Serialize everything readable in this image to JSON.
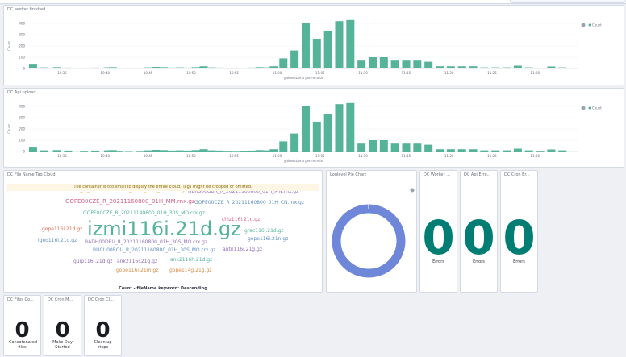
{
  "topbar": {},
  "panels": {
    "worker": {
      "title": "DC worker finished",
      "xlabel": "@timestamp per minute",
      "ylabel": "Count",
      "legend": "Count"
    },
    "upload": {
      "title": "DC Api upload",
      "xlabel": "@timestamp per minute",
      "ylabel": "Count",
      "legend": "Count"
    },
    "tagcloud": {
      "title": "DC File Name Tag Cloud",
      "warning": "The container is too small to display the entire cloud. Tags might be cropped or omitted.",
      "caption": "Count - fileName.keyword: Descending"
    },
    "pie": {
      "title": "Loglevel Pie Chart"
    },
    "metrics": [
      {
        "title": "DC Worker ...",
        "value": "0",
        "label": "Errors"
      },
      {
        "title": "DC Api Erro...",
        "value": "0",
        "label": "Errors"
      },
      {
        "title": "DC Cron Er...",
        "value": "0",
        "label": "Errors"
      }
    ],
    "bottom_metrics": [
      {
        "title": "DC Files Co...",
        "value": "0",
        "label": "Concatenated files"
      },
      {
        "title": "DC Cron M...",
        "value": "0",
        "label": "Make Day Started"
      },
      {
        "title": "DC Cron Cl...",
        "value": "0",
        "label": "Clean up steps"
      }
    ]
  },
  "cloud_words": [
    {
      "text": "WTZ000DEU_R_20211160800_01H_30S_MO.crx.gz",
      "color": "#d6bf57"
    },
    {
      "text": "HERS00GBR_R_20211160800_01H_MN.rnx.gz",
      "color": "#9170b8"
    },
    {
      "text": "GOPE00CZE_R_20211160800_01H_MM.rnx.gz",
      "color": "#d36086"
    },
    {
      "text": "GOPE00CZE_R_20211160800_01H_CN.rnx.gz",
      "color": "#6092c0"
    },
    {
      "text": "GOPE00CZE_R_20211140600_01H_30S_MO.crx.gz",
      "color": "#54b399"
    },
    {
      "text": "chiz116i.21d.gz",
      "color": "#d36086"
    },
    {
      "text": "izmi116i.21d.gz",
      "color": "#54b399"
    },
    {
      "text": "gope116i.21d.gz",
      "color": "#e7664c"
    },
    {
      "text": "grac116i.21d.gz",
      "color": "#54b399"
    },
    {
      "text": "igeo116i.21g.gz",
      "color": "#6092c0"
    },
    {
      "text": "gope116i.21n.gz",
      "color": "#6092c0"
    },
    {
      "text": "BADH00DEU_R_20211160800_01H_30S_MO.crx.gz",
      "color": "#9170b8"
    },
    {
      "text": "BUCU00ROU_R_20211160800_01H_30S_MO.crx.gz",
      "color": "#6092c0"
    },
    {
      "text": "autn116i.21g.gz",
      "color": "#9170b8"
    },
    {
      "text": "guip116i.21d.gz",
      "color": "#9170b8"
    },
    {
      "text": "ank2116i.21g.gz",
      "color": "#9170b8"
    },
    {
      "text": "ank2116h.21d.gz",
      "color": "#54b399"
    },
    {
      "text": "gope116i.21m.gz",
      "color": "#da8b45"
    },
    {
      "text": "gope114g.21g.gz",
      "color": "#da8b45"
    }
  ],
  "chart_data": [
    {
      "type": "bar",
      "title": "DC worker finished",
      "xlabel": "@timestamp per minute",
      "ylabel": "Count",
      "ylim": [
        0,
        400
      ],
      "yticks": [
        0,
        100,
        200,
        300,
        400
      ],
      "xticks": [
        "10:35",
        "10:40",
        "10:45",
        "10:50",
        "10:55",
        "11:00",
        "11:05",
        "11:10",
        "11:15",
        "11:20",
        "11:25",
        "11:30"
      ],
      "xrange": [
        10.5,
        11.6
      ],
      "color": "#54b399",
      "points": [
        [
          10.53,
          35
        ],
        [
          10.6,
          10
        ],
        [
          10.68,
          12
        ],
        [
          10.75,
          8
        ],
        [
          10.85,
          6
        ],
        [
          10.92,
          8
        ],
        [
          11.0,
          10
        ],
        [
          11.03,
          12
        ],
        [
          11.07,
          6
        ],
        [
          11.13,
          4
        ],
        [
          11.2,
          5
        ],
        [
          11.25,
          10
        ],
        [
          11.3,
          14
        ],
        [
          11.35,
          12
        ],
        [
          11.4,
          8
        ],
        [
          11.45,
          10
        ],
        [
          11.5,
          8
        ],
        [
          11.55,
          12
        ],
        [
          11.6,
          20
        ],
        [
          11.65,
          10
        ],
        [
          11.7,
          8
        ],
        [
          11.75,
          6
        ],
        [
          11.8,
          5
        ],
        [
          11.85,
          7
        ],
        [
          11.9,
          8
        ],
        [
          11.95,
          12
        ],
        [
          12.0,
          10
        ],
        [
          12.04,
          20
        ],
        [
          12.1,
          90
        ],
        [
          12.17,
          160
        ],
        [
          12.24,
          400
        ],
        [
          12.31,
          260
        ],
        [
          12.38,
          330
        ],
        [
          12.45,
          420
        ],
        [
          12.52,
          430
        ],
        [
          12.59,
          70
        ],
        [
          12.66,
          100
        ],
        [
          12.73,
          100
        ],
        [
          12.8,
          70
        ],
        [
          12.87,
          70
        ],
        [
          12.94,
          70
        ],
        [
          13.01,
          60
        ],
        [
          13.08,
          20
        ],
        [
          13.15,
          20
        ],
        [
          13.22,
          20
        ],
        [
          13.29,
          20
        ],
        [
          13.36,
          10
        ],
        [
          13.43,
          10
        ],
        [
          13.5,
          10
        ],
        [
          13.57,
          25
        ],
        [
          13.64,
          10
        ],
        [
          13.71,
          6
        ],
        [
          13.78,
          18
        ],
        [
          13.85,
          10
        ]
      ]
    },
    {
      "type": "bar",
      "title": "DC Api upload",
      "xlabel": "@timestamp per minute",
      "ylabel": "Count",
      "ylim": [
        0,
        400
      ],
      "yticks": [
        0,
        100,
        200,
        300,
        400
      ],
      "xticks": [
        "10:35",
        "10:40",
        "10:45",
        "10:50",
        "10:55",
        "11:00",
        "11:05",
        "11:10",
        "11:15",
        "11:20",
        "11:25",
        "11:30"
      ],
      "color": "#54b399",
      "points": [
        [
          10.53,
          35
        ],
        [
          10.6,
          10
        ],
        [
          10.68,
          12
        ],
        [
          10.75,
          8
        ],
        [
          10.85,
          6
        ],
        [
          10.92,
          8
        ],
        [
          11.0,
          10
        ],
        [
          11.03,
          12
        ],
        [
          11.07,
          6
        ],
        [
          11.13,
          4
        ],
        [
          11.2,
          5
        ],
        [
          11.25,
          10
        ],
        [
          11.3,
          14
        ],
        [
          11.35,
          12
        ],
        [
          11.4,
          8
        ],
        [
          11.45,
          10
        ],
        [
          11.5,
          8
        ],
        [
          11.55,
          12
        ],
        [
          11.6,
          20
        ],
        [
          11.65,
          10
        ],
        [
          11.7,
          8
        ],
        [
          11.75,
          6
        ],
        [
          11.8,
          5
        ],
        [
          11.85,
          7
        ],
        [
          11.9,
          8
        ],
        [
          11.95,
          12
        ],
        [
          12.0,
          10
        ],
        [
          12.04,
          20
        ],
        [
          12.1,
          90
        ],
        [
          12.17,
          160
        ],
        [
          12.24,
          400
        ],
        [
          12.31,
          260
        ],
        [
          12.38,
          330
        ],
        [
          12.45,
          420
        ],
        [
          12.52,
          430
        ],
        [
          12.59,
          70
        ],
        [
          12.66,
          100
        ],
        [
          12.73,
          100
        ],
        [
          12.8,
          70
        ],
        [
          12.87,
          70
        ],
        [
          12.94,
          70
        ],
        [
          13.01,
          60
        ],
        [
          13.08,
          20
        ],
        [
          13.15,
          20
        ],
        [
          13.22,
          20
        ],
        [
          13.29,
          20
        ],
        [
          13.36,
          10
        ],
        [
          13.43,
          10
        ],
        [
          13.5,
          10
        ],
        [
          13.57,
          25
        ],
        [
          13.64,
          10
        ],
        [
          13.71,
          6
        ],
        [
          13.78,
          18
        ],
        [
          13.85,
          10
        ]
      ]
    },
    {
      "type": "pie",
      "title": "Loglevel Pie Chart",
      "slices": [
        {
          "name": "",
          "value": 100,
          "color": "#6f87d8"
        }
      ]
    }
  ]
}
